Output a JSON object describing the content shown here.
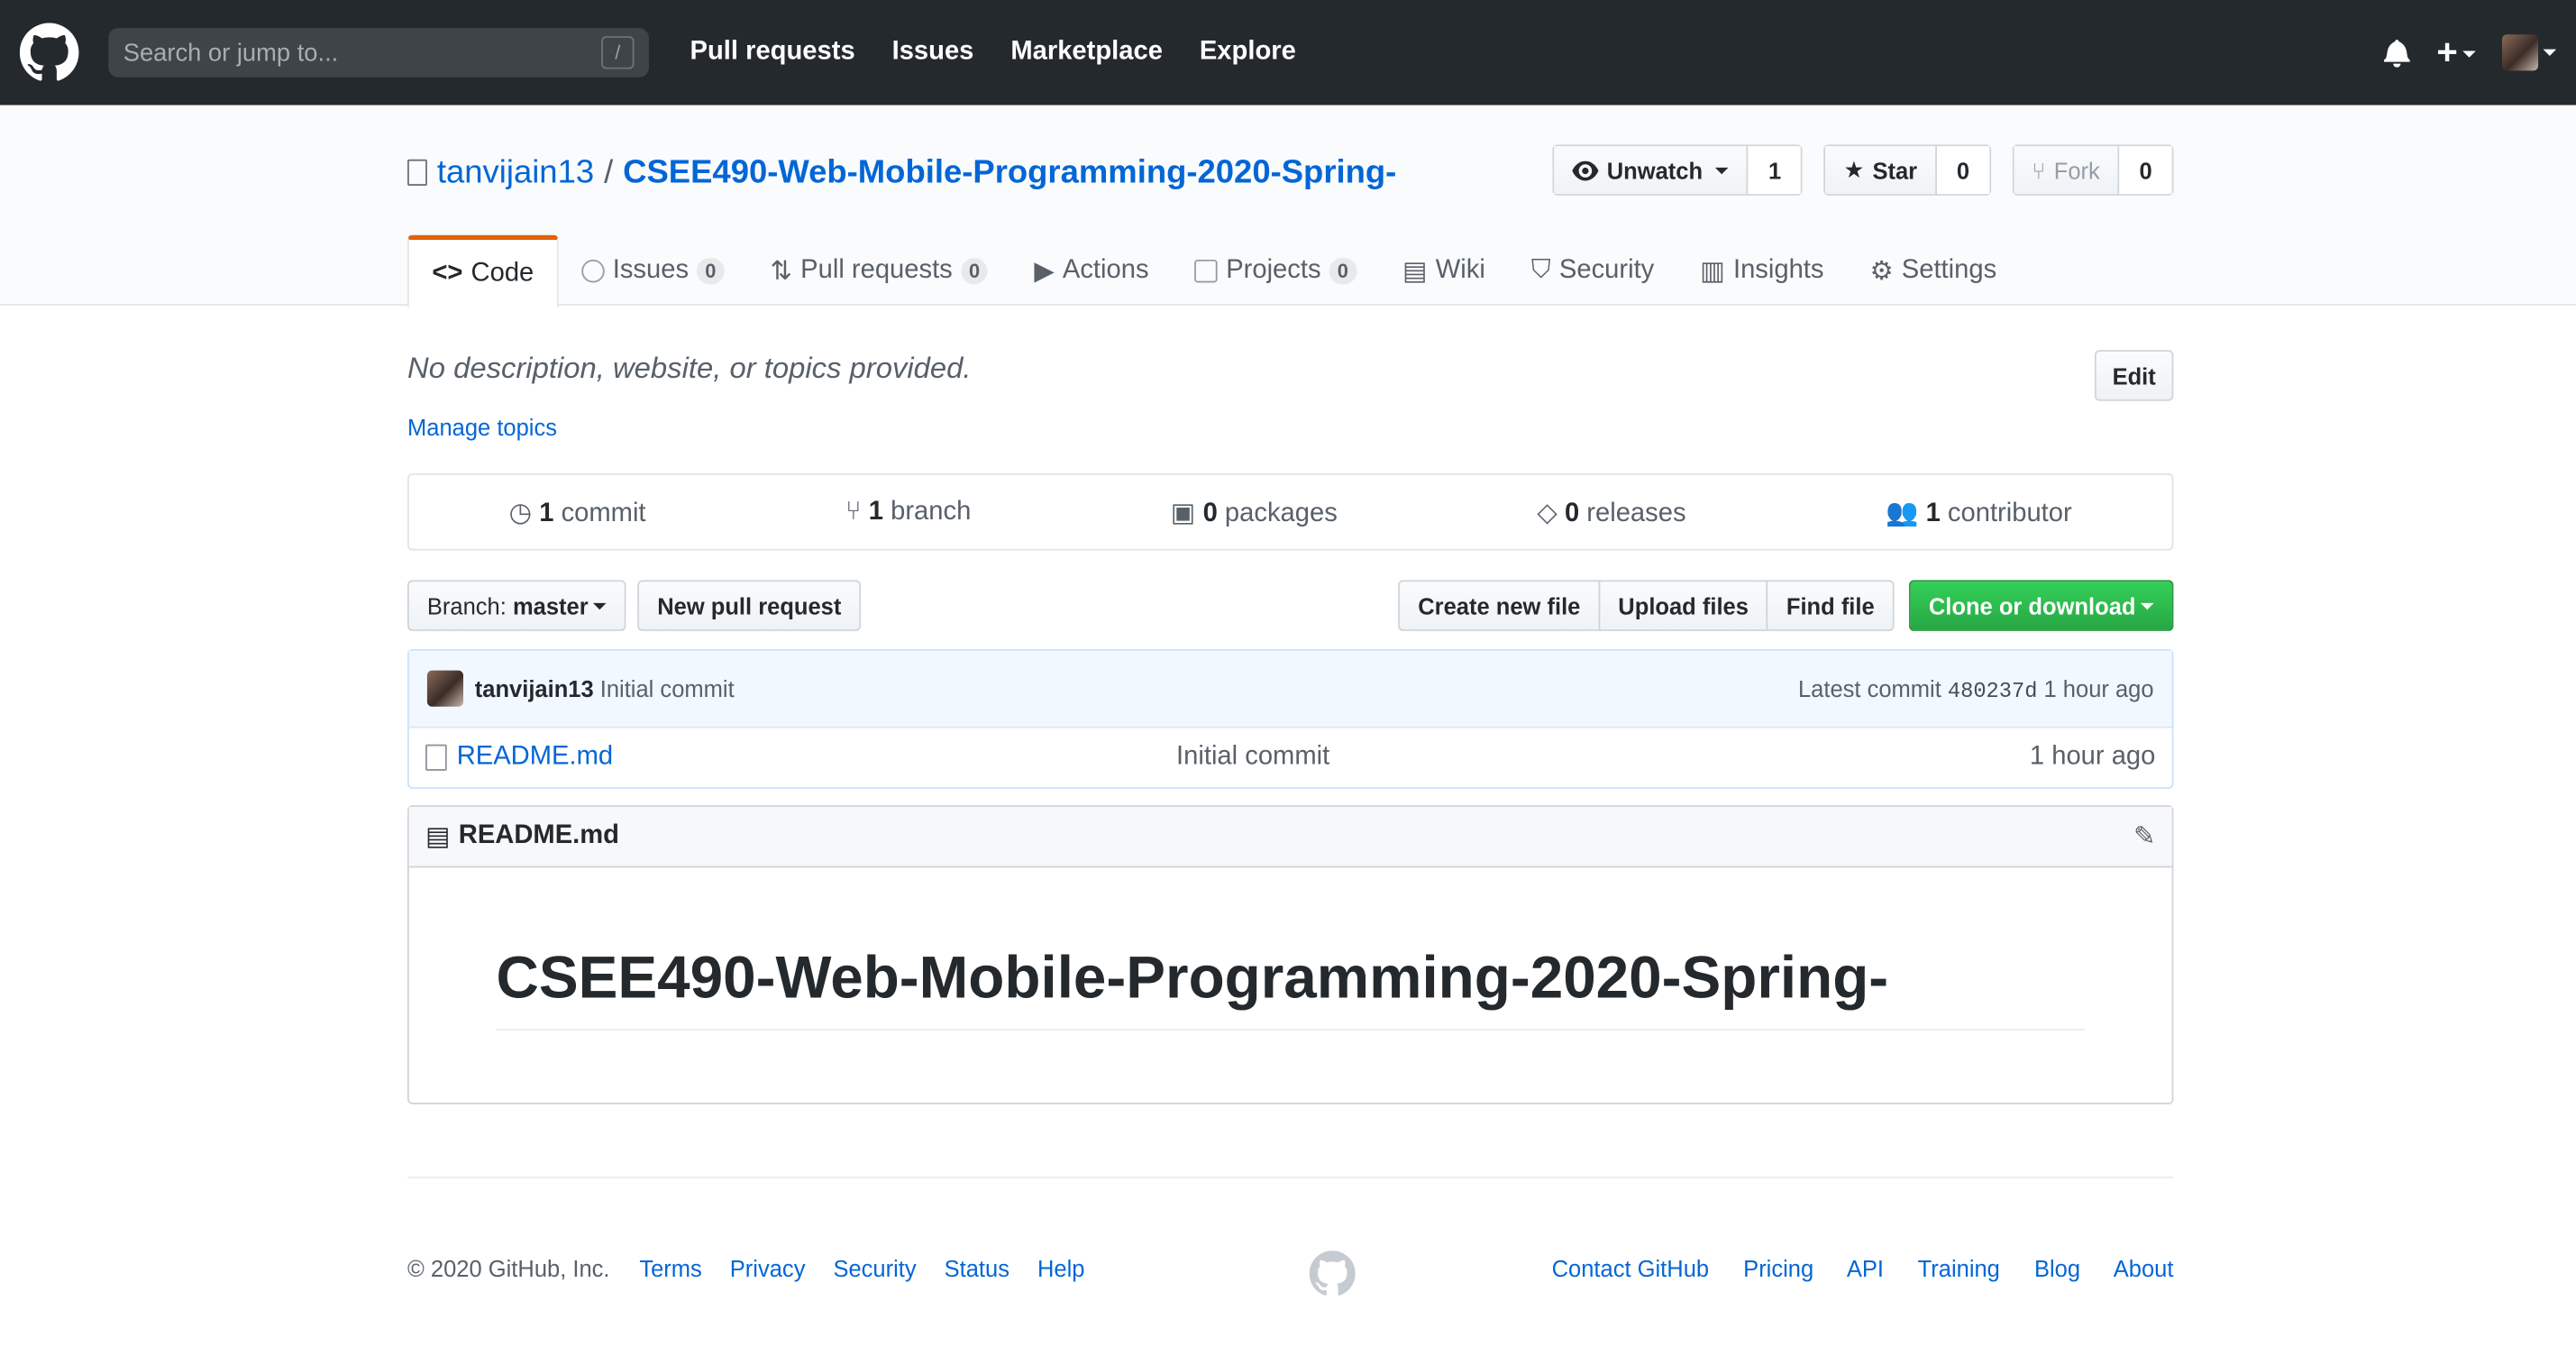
{
  "header": {
    "search_placeholder": "Search or jump to...",
    "search_shortcut": "/",
    "nav": [
      "Pull requests",
      "Issues",
      "Marketplace",
      "Explore"
    ],
    "plus": "+"
  },
  "repo": {
    "owner": "tanvijain13",
    "separator": "/",
    "name": "CSEE490-Web-Mobile-Programming-2020-Spring-",
    "watch_label": "Unwatch",
    "watch_count": "1",
    "star_label": "Star",
    "star_count": "0",
    "fork_label": "Fork",
    "fork_count": "0"
  },
  "tabs": [
    {
      "label": "Code"
    },
    {
      "label": "Issues",
      "count": "0"
    },
    {
      "label": "Pull requests",
      "count": "0"
    },
    {
      "label": "Actions"
    },
    {
      "label": "Projects",
      "count": "0"
    },
    {
      "label": "Wiki"
    },
    {
      "label": "Security"
    },
    {
      "label": "Insights"
    },
    {
      "label": "Settings"
    }
  ],
  "main": {
    "description": "No description, website, or topics provided.",
    "edit_label": "Edit",
    "manage_topics": "Manage topics",
    "summary": [
      {
        "num": "1",
        "label": "commit"
      },
      {
        "num": "1",
        "label": "branch"
      },
      {
        "num": "0",
        "label": "packages"
      },
      {
        "num": "0",
        "label": "releases"
      },
      {
        "num": "1",
        "label": "contributor"
      }
    ],
    "branch_prefix": "Branch:",
    "branch_name": "master",
    "new_pr": "New pull request",
    "create_file": "Create new file",
    "upload_files": "Upload files",
    "find_file": "Find file",
    "clone": "Clone or download"
  },
  "commit": {
    "author": "tanvijain13",
    "message": "Initial commit",
    "latest_label": "Latest commit",
    "sha": "480237d",
    "age": "1 hour ago"
  },
  "files": [
    {
      "name": "README.md",
      "message": "Initial commit",
      "age": "1 hour ago"
    }
  ],
  "readme": {
    "filename": "README.md",
    "heading": "CSEE490-Web-Mobile-Programming-2020-Spring-"
  },
  "footer": {
    "copyright": "© 2020 GitHub, Inc.",
    "left_links": [
      "Terms",
      "Privacy",
      "Security",
      "Status",
      "Help"
    ],
    "right_links": [
      "Contact GitHub",
      "Pricing",
      "API",
      "Training",
      "Blog",
      "About"
    ]
  },
  "colors": {
    "header_bg": "#24292e",
    "link": "#0366d6",
    "accent": "#e36209",
    "clone_bg": "#28a745"
  }
}
